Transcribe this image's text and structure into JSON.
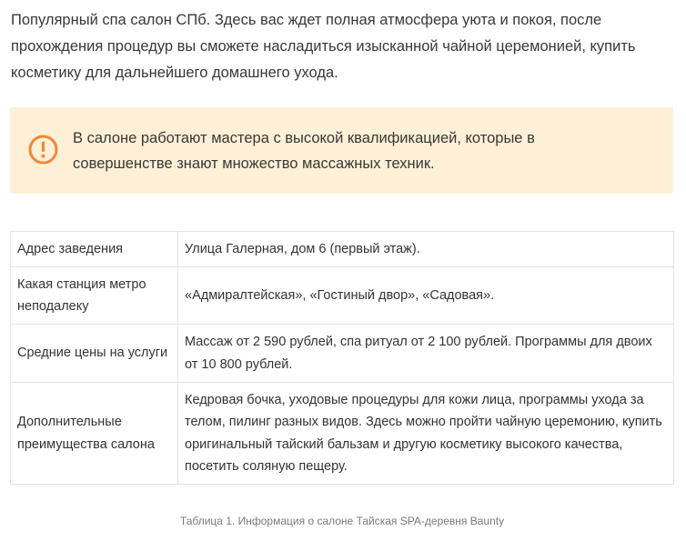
{
  "intro": {
    "text": "Популярный спа салон СПб. Здесь вас ждет полная атмосфера уюта и покоя, после прохождения процедур вы сможете насладиться изысканной чайной церемонией, купить косметику для дальнейшего домашнего ухода."
  },
  "notice": {
    "icon": "exclamation-circle-icon",
    "icon_color": "#f0883a",
    "background": "#fdf0d6",
    "text": "В салоне работают мастера с высокой квалификацией, которые в совершенстве знают множество массажных техник."
  },
  "table": {
    "rows": [
      {
        "label": "Адрес заведения",
        "value": "Улица Галерная, дом 6 (первый этаж)."
      },
      {
        "label": "Какая станция метро неподалеку",
        "value": "«Адмиралтейская», «Гостиный двор», «Садовая»."
      },
      {
        "label": "Средние цены на услуги",
        "value": "Массаж от 2 590 рублей, спа ритуал от 2 100 рублей. Программы для двоих от 10 800 рублей."
      },
      {
        "label": "Дополнительные преимущества салона",
        "value": "Кедровая бочка, уходовые процедуры для кожи лица, программы ухода за телом, пилинг разных видов. Здесь можно пройти чайную церемонию, купить оригинальный тайский бальзам и другую косметику высокого качества, посетить соляную пещеру."
      }
    ],
    "caption": "Таблица 1. Информация о салоне Тайская SPA-деревня Baunty"
  }
}
